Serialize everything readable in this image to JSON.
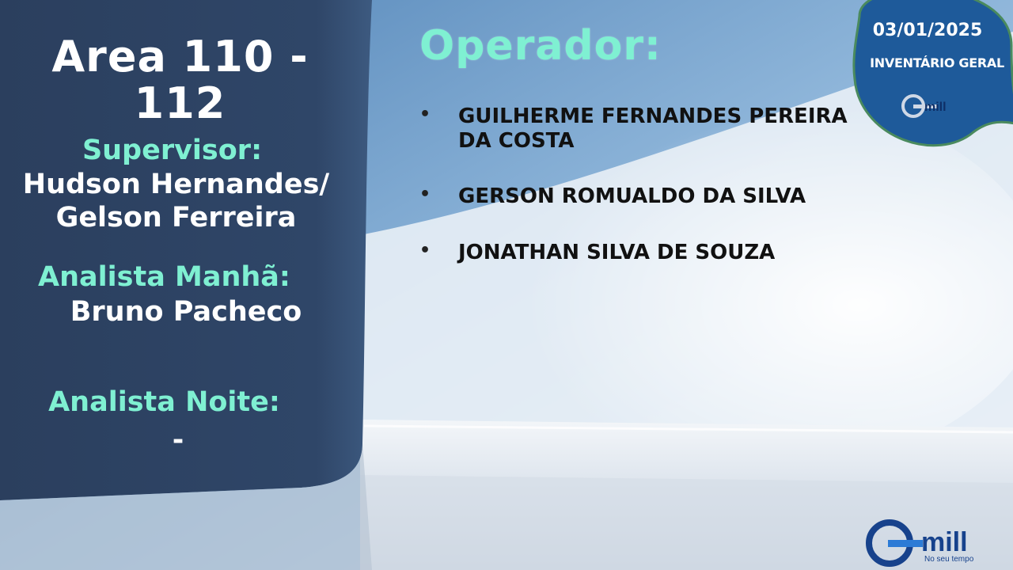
{
  "area": {
    "title": "Area 110 - 112"
  },
  "supervisor": {
    "label": "Supervisor:",
    "value": "Hudson Hernandes/\nGelson Ferreira"
  },
  "analista_manha": {
    "label": "Analista Manhã:",
    "value": "Bruno Pacheco"
  },
  "analista_noite": {
    "label": "Analista Noite:",
    "value": "-"
  },
  "operador": {
    "label": "Operador:",
    "items": [
      {
        "bullet": "•",
        "name": "GUILHERME FERNANDES PEREIRA DA COSTA"
      },
      {
        "bullet": "•",
        "name": "GERSON ROMUALDO DA SILVA"
      },
      {
        "bullet": "•",
        "name": "JONATHAN SILVA DE SOUZA"
      }
    ]
  },
  "badge": {
    "date": "03/01/2025",
    "subtitle": "INVENTÁRIO GERAL",
    "logo_text": "Gmill"
  },
  "brand": {
    "logo_text": "Gmill",
    "tagline": "No seu tempo"
  },
  "colors": {
    "panel": "#2a3f5f",
    "accent_teal": "#7ff0d2",
    "badge_fill": "#1e5a9a",
    "badge_border": "#4a8a5e",
    "logo_blue": "#17428c"
  }
}
